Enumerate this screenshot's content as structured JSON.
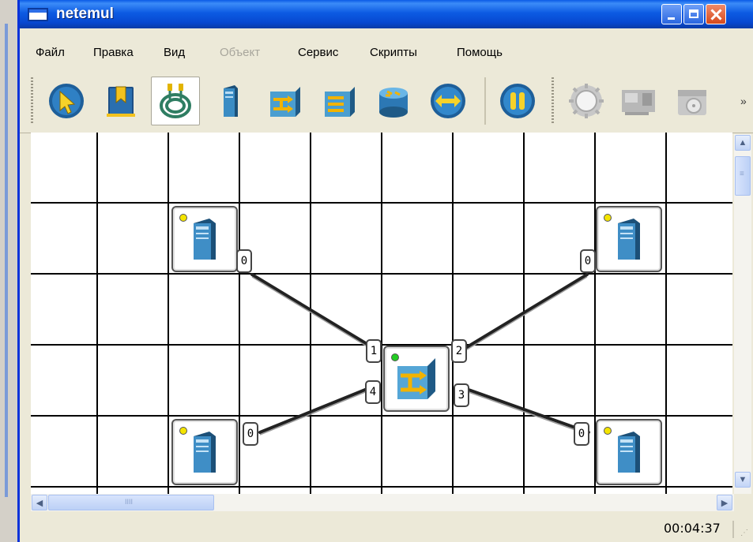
{
  "window": {
    "title": "netemul"
  },
  "menu": [
    "Файл",
    "Правка",
    "Вид",
    "Объект",
    "Сервис",
    "Скрипты",
    "Помощь"
  ],
  "menu_disabled": [
    false,
    false,
    false,
    true,
    false,
    false,
    false
  ],
  "toolbar": {
    "tools": [
      {
        "name": "select-tool",
        "icon": "pointer-arrow-icon"
      },
      {
        "name": "note-tool",
        "icon": "bookmark-icon"
      },
      {
        "name": "cable-tool",
        "icon": "cable-icon",
        "active": true
      },
      {
        "name": "computer-tool",
        "icon": "computer-icon"
      },
      {
        "name": "switch-tool",
        "icon": "switch-icon"
      },
      {
        "name": "hub-tool",
        "icon": "hub-icon"
      },
      {
        "name": "router-tool",
        "icon": "router-icon"
      },
      {
        "name": "connection-tool",
        "icon": "double-arrow-icon"
      },
      {
        "name": "pause-tool",
        "icon": "pause-icon"
      },
      {
        "name": "settings-tool",
        "icon": "gear-icon",
        "disabled": true
      },
      {
        "name": "network-card-tool",
        "icon": "network-card-icon",
        "disabled": true
      },
      {
        "name": "disk-tool",
        "icon": "disk-icon",
        "disabled": true
      }
    ],
    "overflow": "»"
  },
  "network": {
    "devices": [
      {
        "id": "pc-top-left",
        "type": "computer",
        "led": "yellow",
        "port": "0"
      },
      {
        "id": "pc-top-right",
        "type": "computer",
        "led": "yellow",
        "port": "0"
      },
      {
        "id": "pc-bottom-left",
        "type": "computer",
        "led": "yellow",
        "port": "0"
      },
      {
        "id": "pc-bottom-right",
        "type": "computer",
        "led": "yellow",
        "port": "0"
      },
      {
        "id": "switch",
        "type": "switch",
        "led": "green",
        "ports": [
          "1",
          "2",
          "3",
          "4"
        ]
      }
    ],
    "links": [
      {
        "from": "pc-top-left:0",
        "to": "switch:1"
      },
      {
        "from": "pc-top-right:0",
        "to": "switch:2"
      },
      {
        "from": "pc-bottom-right:0",
        "to": "switch:3"
      },
      {
        "from": "pc-bottom-left:0",
        "to": "switch:4"
      }
    ]
  },
  "scroll": {
    "hthumb_grip": "IIII",
    "vthumb_grip": "≡"
  },
  "status": {
    "time": "00:04:37"
  },
  "colors": {
    "titlebar": "#0c5be3",
    "frame": "#0831d9",
    "led_yellow": "#f4e400",
    "led_green": "#22cc22",
    "device_blue": "#2f7fb5",
    "switch_arrow": "#f2b300"
  }
}
